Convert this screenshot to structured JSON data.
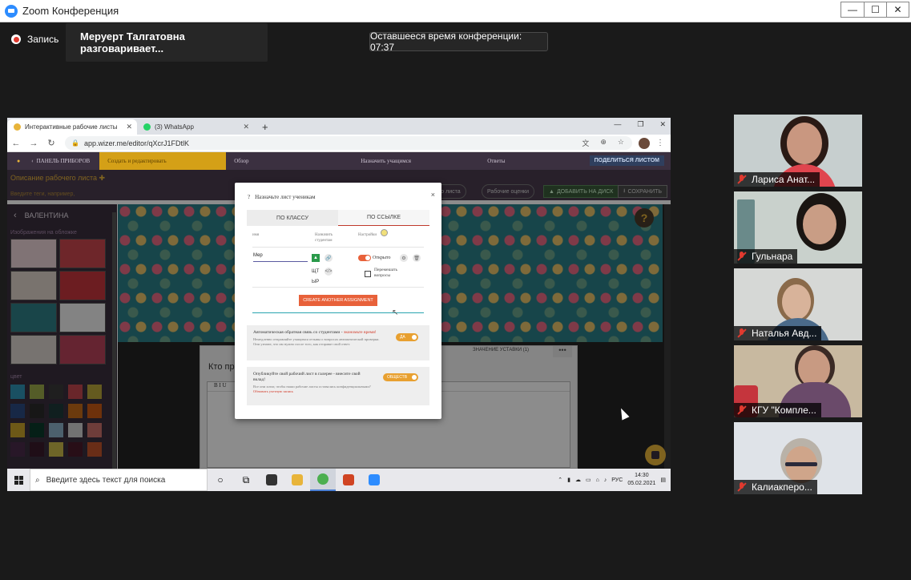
{
  "zoom": {
    "title": "Zoom Конференция",
    "recording_label": "Запись",
    "speaking_label": "Меруерт Талгатовна разговаривает...",
    "timer_label": "Оставшееся время конференции: 07:37",
    "win_controls": [
      "—",
      "☐",
      "✕"
    ]
  },
  "browser": {
    "tabs": [
      {
        "title": "Интерактивные рабочие листы",
        "icon": "wizer-icon",
        "color": "#e8b43a"
      },
      {
        "title": "(3) WhatsApp",
        "icon": "whatsapp-icon",
        "color": "#25d366"
      }
    ],
    "new_tab": "+",
    "url": "app.wizer.me/editor/qXcrJ1FDtlK",
    "win_controls": [
      "—",
      "❐",
      "✕"
    ]
  },
  "wizer_nav": {
    "dashboard": "ПАНЕЛЬ ПРИБОРОВ",
    "steps": [
      "Создать и редактировать",
      "Обзор",
      "Назначить учащимся",
      "Ответы"
    ],
    "share": "ПОДЕЛИТЬСЯ ЛИСТОМ"
  },
  "wizer_head": {
    "title": "Описание рабочего листа",
    "tags_placeholder": "Введите теги, например,",
    "btn_worksheet": "его листа",
    "btn_assessment": "Рабочие оценки",
    "btn_drive": "ДОБАВИТЬ НА ДИСК",
    "btn_save": "СОХРАНИТЬ"
  },
  "sidebar": {
    "back_label": "ВАЛЕНТИНА",
    "covers_label": "Изображения на обложке",
    "colors_label": "цвет",
    "thumbs": [
      "#e9d2d6",
      "#c9454e",
      "#ddd2c8",
      "#c5353d",
      "#2e7f86",
      "#eeeeee",
      "#d9d2cc",
      "#b8425a"
    ],
    "swatches": [
      "#2e93b2",
      "#9aa84a",
      "#3a3a3a",
      "#c0454e",
      "#b7a43a",
      "#2a4a80",
      "#2a2a2a",
      "#1e3a3a",
      "#c46a18",
      "#c85a14",
      "#c7a02a",
      "#0a3a2a",
      "#8ab0c6",
      "#cfcfcf",
      "#c8706a",
      "#4a2a4a",
      "#3a1a2a",
      "#c9b84a",
      "#4a1a2a",
      "#c0522a"
    ]
  },
  "document": {
    "title": "Кто пр",
    "inserts_label": "ЗНАЧЕНИЕ УСТАВКИ (1)",
    "more": "•••",
    "toolbar": "B I U"
  },
  "modal": {
    "header": "Назначьте лист ученикам",
    "help": "?",
    "close": "×",
    "tabs": [
      "ПО КЛАССУ",
      "ПО ССЫЛКЕ"
    ],
    "col_name": "имя",
    "col_students": "Назначить студентам",
    "col_settings": "Настройки",
    "name_value": "Мер",
    "status": "Открыто",
    "code_lines": [
      "ЩТ",
      "ЫР"
    ],
    "shuffle": "Перемешать вопросы",
    "create_btn": "CREATE ANOTHER ASSIGNMENT",
    "auto_feedback_title": "Автоматическая обратная связь со студентами - ",
    "auto_feedback_highlight": "экономьте время!",
    "auto_feedback_sub1": "Немедленно отправляйте учащимся отзывы о вопросах автоматической проверки.",
    "auto_feedback_sub2": "Они узнают, что им нужно после того, как отправят свой ответ.",
    "auto_toggle": "ДА",
    "publish_title": "Опубликуйте свой рабочий лист в галерее - внесите свой вклад!",
    "publish_sub": "Все они хотят, чтобы наши рабочие листы оставались конфиденциальными?",
    "publish_link": "Обновить учетную запись",
    "publish_toggle": "ОБЩЕСТВ"
  },
  "taskbar": {
    "search_placeholder": "Введите здесь текст для поиска",
    "lang": "РУС",
    "time": "14:30",
    "date": "05.02.2021"
  },
  "participants": [
    {
      "name": "Лариса Анат...",
      "bg": "#c7cfcf",
      "face": "#c99780",
      "hair": "#2a1a15"
    },
    {
      "name": "Гульнара",
      "bg": "#c9d1cc",
      "face": "#c99d85",
      "hair": "#1a1512"
    },
    {
      "name": "Наталья Авд...",
      "bg": "#d6d8d6",
      "face": "#d8b39a",
      "hair": "#8a6a4a"
    },
    {
      "name": "КГУ \"Компле...",
      "bg": "#c8b9a0",
      "face": "#c89a82",
      "hair": "#3a2a25"
    },
    {
      "name": "Калиакперо...",
      "bg": "#dfe3e8",
      "face": "#cfa58a",
      "hair": "#b9b2a8"
    }
  ]
}
